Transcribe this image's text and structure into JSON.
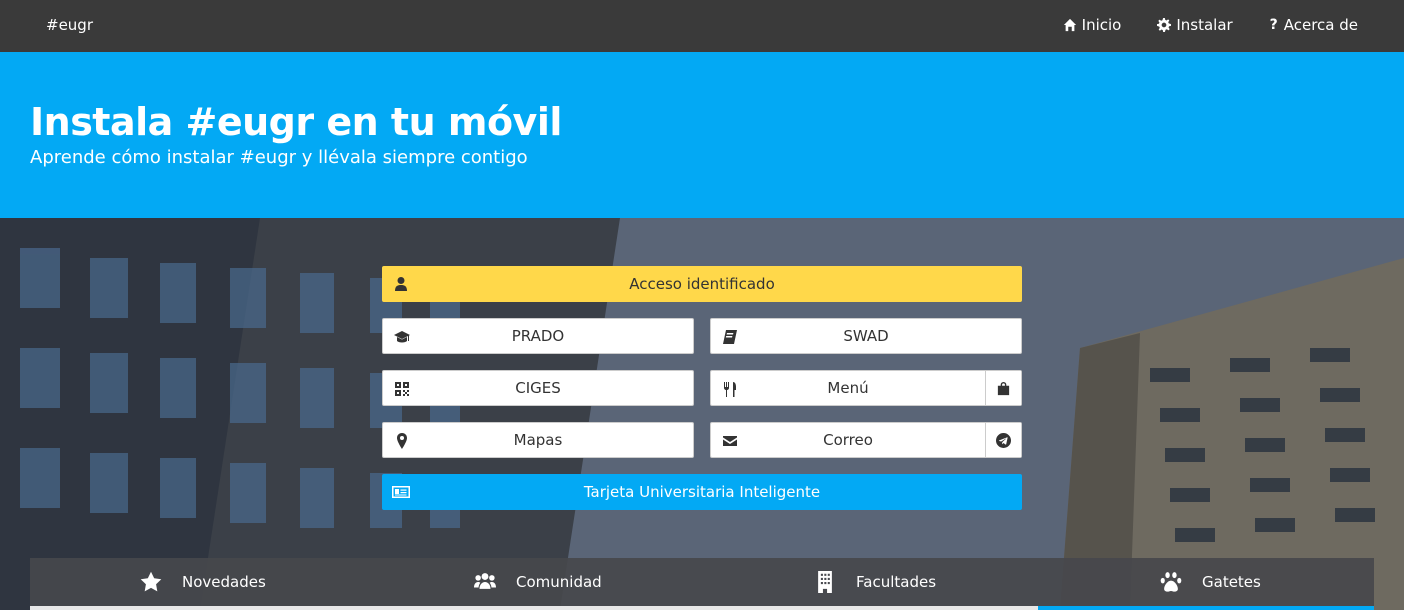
{
  "navbar": {
    "brand": "#eugr",
    "links": [
      {
        "label": "Inicio",
        "icon": "home-icon"
      },
      {
        "label": "Instalar",
        "icon": "gear-icon"
      },
      {
        "label": "Acerca de",
        "icon": "question-icon"
      }
    ]
  },
  "hero": {
    "title": "Instala #eugr en tu móvil",
    "subtitle": "Aprende cómo instalar #eugr y llévala siempre contigo"
  },
  "buttons": {
    "login": "Acceso identificado",
    "prado": "PRADO",
    "swad": "SWAD",
    "ciges": "CIGES",
    "menu": "Menú",
    "mapas": "Mapas",
    "correo": "Correo",
    "tui": "Tarjeta Universitaria Inteligente"
  },
  "tabs": [
    {
      "label": "Novedades",
      "icon": "star-icon"
    },
    {
      "label": "Comunidad",
      "icon": "users-icon"
    },
    {
      "label": "Facultades",
      "icon": "building-icon"
    },
    {
      "label": "Gatetes",
      "icon": "paw-icon"
    }
  ],
  "active_tab": "Gatetes",
  "colors": {
    "navbar": "#3a3a3a",
    "accent": "#03a9f4",
    "login_button": "#ffd84a"
  }
}
